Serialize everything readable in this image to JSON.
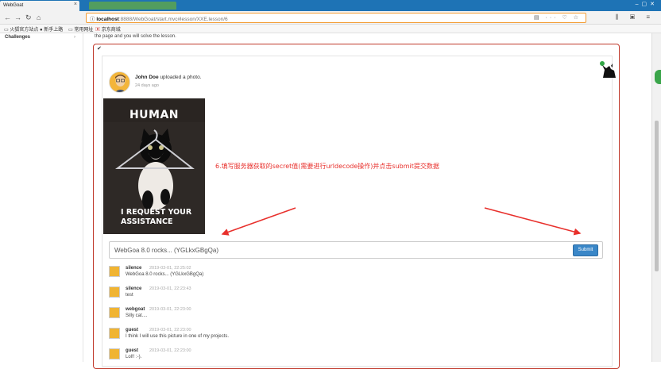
{
  "browser": {
    "tab_title": "WebGoat",
    "tab_close": "×",
    "url_host": "localhost",
    "url_path": ":8888/WebGoat/start.mvc#lesson/XXE.lesson/6",
    "bookmarks": [
      "火狐官方站点",
      "新手上路",
      "常用网址",
      "京东商城"
    ]
  },
  "sidebar": {
    "title": "Challenges",
    "arrow": "›"
  },
  "lesson": {
    "intro": "the page and you will solve the lesson.",
    "check_icon": "✔",
    "poster_name": "John Doe",
    "poster_action": "uploaded a photo.",
    "poster_time": "24 days ago",
    "photo_top_caption": "HUMAN",
    "photo_bottom_caption_1": "I REQUEST YOUR",
    "photo_bottom_caption_2": "ASSISTANCE",
    "comment_value": "WebGoa 8.0 rocks... (YGLkxGBgQa)",
    "submit_label": "Submit",
    "annotation": "6.填写服务器获取的secret值(需要进行urldecode操作)并点击submit提交数据"
  },
  "comments": [
    {
      "user": "silence",
      "date": "2019-03-01, 22:25:02",
      "text": "WebGoa 8.0 rocks... (YGLkxGBgQa)"
    },
    {
      "user": "silence",
      "date": "2019-03-01, 22:23:43",
      "text": "test"
    },
    {
      "user": "webgoat",
      "date": "2019-03-01, 22:23:00",
      "text": "Silly cat...."
    },
    {
      "user": "guest",
      "date": "2019-03-01, 22:23:00",
      "text": "I think I will use this picture in one of my projects."
    },
    {
      "user": "guest",
      "date": "2019-03-01, 22:23:00",
      "text": "Lol!! :-)."
    }
  ],
  "colors": {
    "accent": "#3a87c8",
    "annotation": "#e8302c",
    "panel_border": "#c0392b"
  }
}
